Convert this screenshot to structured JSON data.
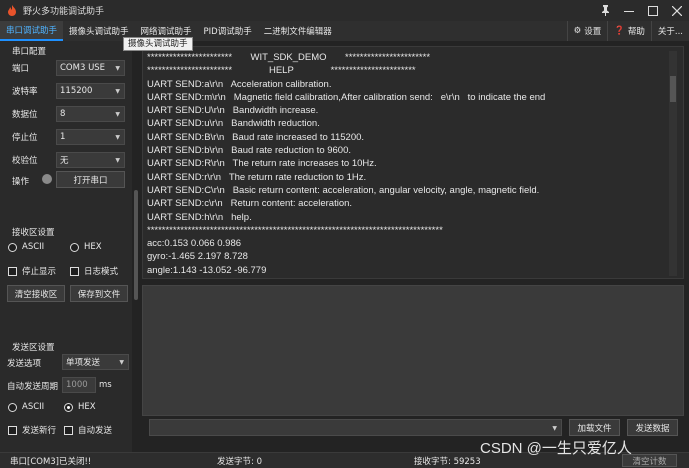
{
  "window": {
    "title": "野火多功能调试助手",
    "pin_icon": "pin-icon",
    "minimize_icon": "minimize-icon",
    "maximize_icon": "maximize-icon",
    "close_icon": "close-icon"
  },
  "tabs": [
    "串口调试助手",
    "摄像头调试助手",
    "网络调试助手",
    "PID调试助手",
    "二进制文件编辑器"
  ],
  "tooltip": "摄像头调试助手",
  "tools": {
    "settings": "设置",
    "help": "帮助",
    "about": "关于..."
  },
  "serial_config": {
    "title": "串口配置",
    "port_label": "端口",
    "port_value": "COM3 USE",
    "baud_label": "波特率",
    "baud_value": "115200",
    "data_bits_label": "数据位",
    "data_bits_value": "8",
    "stop_bits_label": "停止位",
    "stop_bits_value": "1",
    "parity_label": "校验位",
    "parity_value": "无",
    "op_label": "操作",
    "open_button": "打开串口"
  },
  "receive": {
    "title": "接收区设置",
    "ascii": "ASCII",
    "hex": "HEX",
    "selected": "ASCII",
    "stop_display": "停止显示",
    "log_mode": "日志模式",
    "clear_button": "清空接收区",
    "save_button": "保存到文件"
  },
  "send": {
    "title": "发送区设置",
    "option_label": "发送选项",
    "option_value": "单项发送",
    "period_label": "自动发送周期",
    "period_value": "1000",
    "period_unit": "ms",
    "ascii": "ASCII",
    "hex": "HEX",
    "selected": "HEX",
    "send_newline": "发送新行",
    "auto_send": "自动发送",
    "load_file_button": "加载文件",
    "send_button": "发送数据"
  },
  "receive_text": [
    "***********************       WIT_SDK_DEMO       ***********************",
    "***********************              HELP              ***********************",
    "UART SEND:a\\r\\n   Acceleration calibration.",
    "UART SEND:m\\r\\n   Magnetic field calibration,After calibration send:   e\\r\\n   to indicate the end",
    "UART SEND:U\\r\\n   Bandwidth increase.",
    "UART SEND:u\\r\\n   Bandwidth reduction.",
    "UART SEND:B\\r\\n   Baud rate increased to 115200.",
    "UART SEND:b\\r\\n   Baud rate reduction to 9600.",
    "UART SEND:R\\r\\n   The return rate increases to 10Hz.",
    "UART SEND:r\\r\\n   The return rate reduction to 1Hz.",
    "UART SEND:C\\r\\n   Basic return content: acceleration, angular velocity, angle, magnetic field.",
    "UART SEND:c\\r\\n   Return content: acceleration.",
    "UART SEND:h\\r\\n   help.",
    "********************************************************************************",
    "acc:0.153 0.066 0.986",
    "gyro:-1.465 2.197 8.728",
    "angle:1.143 -13.052 -96.779"
  ],
  "status": {
    "port": "串口[COM3]已关闭!!",
    "sent": "发送字节: 0",
    "received": "接收字节: 59253",
    "clear_counter": "清空计数"
  },
  "watermark": "CSDN @一生只爱亿人",
  "colors": {
    "accent": "#1e90ff",
    "background": "#232323"
  }
}
